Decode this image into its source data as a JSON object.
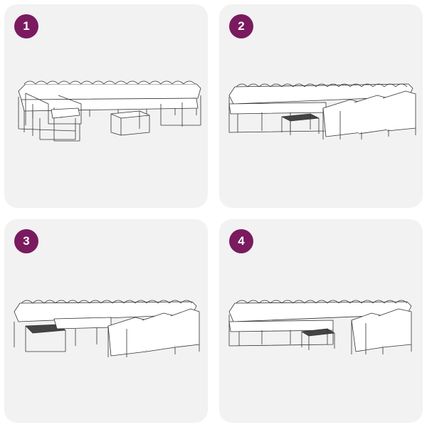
{
  "accent_color": "#7a1a5f",
  "panels": [
    {
      "number": "1",
      "illustration": "u-shaped-sofa-set-illustration"
    },
    {
      "number": "2",
      "illustration": "sofa-set-arrangement-illustration"
    },
    {
      "number": "3",
      "illustration": "sofa-set-arrangement-illustration"
    },
    {
      "number": "4",
      "illustration": "sofa-set-arrangement-illustration"
    }
  ]
}
